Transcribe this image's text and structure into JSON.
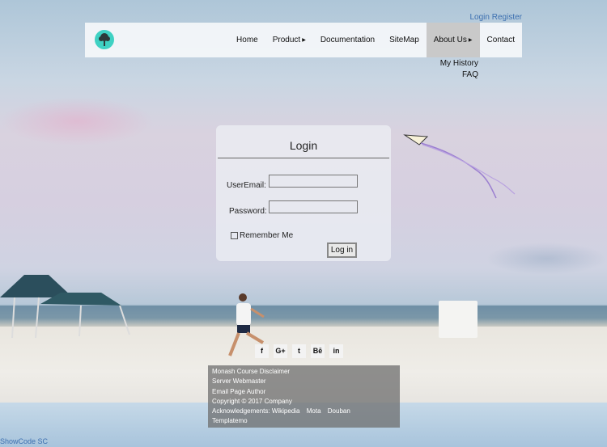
{
  "auth": {
    "login": "Login",
    "register": "Register"
  },
  "nav": {
    "items": [
      {
        "label": "Home"
      },
      {
        "label": "Product"
      },
      {
        "label": "Documentation"
      },
      {
        "label": "SiteMap"
      },
      {
        "label": "About Us"
      },
      {
        "label": "Contact"
      }
    ],
    "about_submenu": [
      "My History",
      "FAQ"
    ]
  },
  "login_form": {
    "title": "Login",
    "email_label": "UserEmail:",
    "password_label": "Password:",
    "remember_label": "Remember Me",
    "submit_label": "Log in"
  },
  "social": [
    "f",
    "G+",
    "t",
    "Bē",
    "in"
  ],
  "footer": {
    "line1": [
      "Monash",
      "Course",
      "Disclaimer"
    ],
    "line2": [
      "Server",
      "Webmaster"
    ],
    "line3": [
      "Email",
      "Page Author"
    ],
    "copyright": "Copyright © 2017 Company",
    "ack_label": "Acknowledgements:",
    "ack_items": [
      "Wikipedia",
      "Mota",
      "Douban"
    ],
    "templatemo": "Templatemo"
  },
  "bottom_link": "ShowCode SC",
  "colors": {
    "link": "#3c6fb0",
    "logo": "#3fd1c3"
  }
}
